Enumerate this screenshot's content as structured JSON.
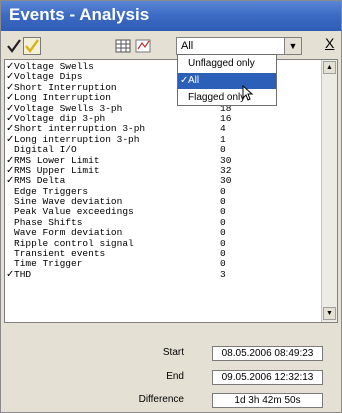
{
  "window": {
    "title": "Events - Analysis"
  },
  "toolbar": {
    "filter_value": "All",
    "close_label": "X"
  },
  "filter_menu": {
    "options": [
      {
        "label": "Unflagged only",
        "checked": false
      },
      {
        "label": "All",
        "checked": true
      },
      {
        "label": "Flagged only",
        "checked": false
      }
    ]
  },
  "events": [
    {
      "checked": true,
      "name": "Voltage Swells",
      "count": ""
    },
    {
      "checked": true,
      "name": "Voltage Dips",
      "count": ""
    },
    {
      "checked": true,
      "name": "Short Interruption",
      "count": ""
    },
    {
      "checked": true,
      "name": "Long Interruption",
      "count": ""
    },
    {
      "checked": true,
      "name": "Voltage Swells 3-ph",
      "count": "18"
    },
    {
      "checked": true,
      "name": "Voltage dip 3-ph",
      "count": "16"
    },
    {
      "checked": true,
      "name": "Short interruption 3-ph",
      "count": "4"
    },
    {
      "checked": true,
      "name": "Long interruption 3-ph",
      "count": "1"
    },
    {
      "checked": false,
      "name": "Digital I/O",
      "count": "0"
    },
    {
      "checked": true,
      "name": "RMS Lower Limit",
      "count": "30"
    },
    {
      "checked": true,
      "name": "RMS Upper Limit",
      "count": "32"
    },
    {
      "checked": true,
      "name": "RMS Delta",
      "count": "30"
    },
    {
      "checked": false,
      "name": "Edge Triggers",
      "count": "0"
    },
    {
      "checked": false,
      "name": "Sine Wave deviation",
      "count": "0"
    },
    {
      "checked": false,
      "name": "Peak Value exceedings",
      "count": "0"
    },
    {
      "checked": false,
      "name": "Phase Shifts",
      "count": "0"
    },
    {
      "checked": false,
      "name": "Wave Form deviation",
      "count": "0"
    },
    {
      "checked": false,
      "name": "Ripple control signal",
      "count": "0"
    },
    {
      "checked": false,
      "name": "Transient events",
      "count": "0"
    },
    {
      "checked": false,
      "name": "Time Trigger",
      "count": "0"
    },
    {
      "checked": true,
      "name": "THD",
      "count": "3"
    }
  ],
  "summary": {
    "start_label": "Start",
    "start_value": "08.05.2006  08:49:23",
    "end_label": "End",
    "end_value": "09.05.2006  12:32:13",
    "difference_label": "Difference",
    "difference_value": "1d  3h 42m 50s"
  },
  "colors": {
    "title_bar": "#3d6cc4",
    "selection": "#2c5fb8",
    "check_green": "#2e8b2e",
    "check_yellow": "#d7b21a"
  }
}
